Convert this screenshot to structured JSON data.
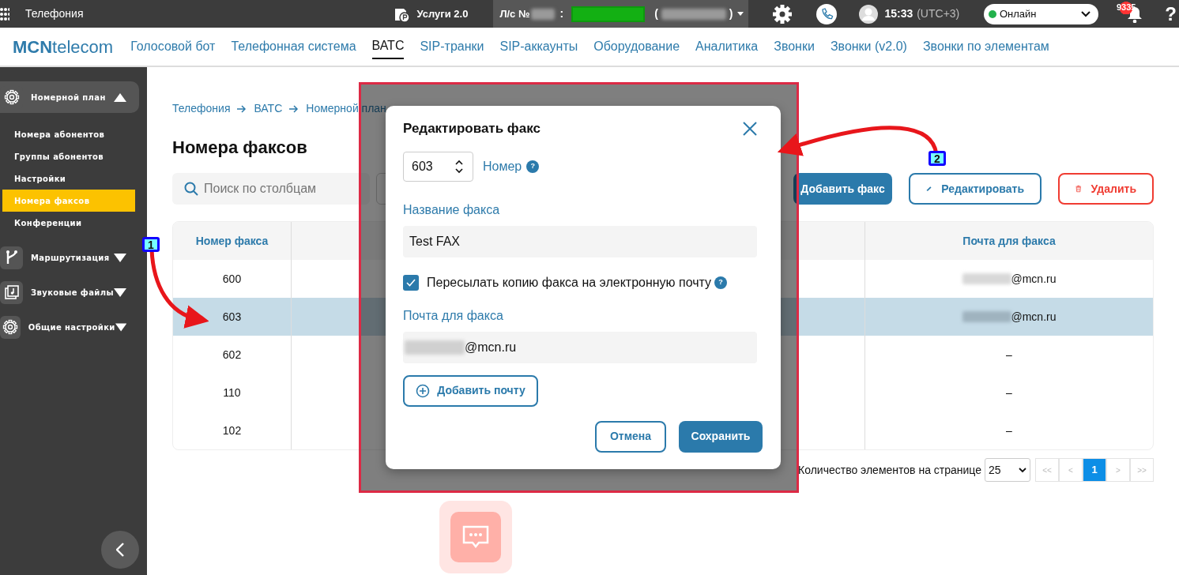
{
  "topbar": {
    "app_title": "Телефония",
    "services": "Услуги 2.0",
    "account_label": "Л/с №",
    "account_sep": ":",
    "paren_open": "(",
    "paren_close": ")",
    "time": "15:33",
    "timezone": "(UTC+3)",
    "status": {
      "label": "Онлайн",
      "color": "#22b14c"
    },
    "notifications": "9335",
    "help": "?"
  },
  "navbar": {
    "logo": "**MCN**telecom",
    "links": [
      {
        "label": "Голосовой бот",
        "selected": false
      },
      {
        "label": "Телефонная система",
        "selected": false
      },
      {
        "label": "ВАТС",
        "selected": true
      },
      {
        "label": "SIP-транки",
        "selected": false
      },
      {
        "label": "SIP-аккаунты",
        "selected": false
      },
      {
        "label": "Оборудование",
        "selected": false
      },
      {
        "label": "Аналитика",
        "selected": false
      },
      {
        "label": "Звонки",
        "selected": false
      },
      {
        "label": "Звонки (v2.0)",
        "selected": false
      },
      {
        "label": "Звонки по элементам",
        "selected": false
      }
    ]
  },
  "sidebar": {
    "sections": [
      {
        "label": "Номерной план",
        "kind": "gear",
        "expanded": true,
        "children": [
          {
            "label": "Номера абонентов",
            "selected": false
          },
          {
            "label": "Группы абонентов",
            "selected": false
          },
          {
            "label": "Настройки",
            "selected": false
          },
          {
            "label": "Номера факсов",
            "selected": true
          },
          {
            "label": "Конференции",
            "selected": false
          }
        ]
      },
      {
        "label": "Маршрутизация",
        "kind": "branch",
        "expanded": false
      },
      {
        "label": "Звуковые файлы",
        "kind": "music",
        "expanded": false
      },
      {
        "label": "Общие настройки",
        "kind": "gear",
        "expanded": false
      }
    ]
  },
  "breadcrumb": [
    "Телефония",
    "ВАТС",
    "Номерной план"
  ],
  "page_title": "Номера факсов",
  "search": {
    "placeholder": "Поиск по столбцам"
  },
  "buttons": [
    {
      "label": "Добавить факс",
      "kind": "primary"
    },
    {
      "label": "Редактировать",
      "kind": "edit"
    },
    {
      "label": "Удалить",
      "kind": "delete"
    }
  ],
  "table": {
    "columns": [
      {
        "label": "Номер факса"
      },
      {
        "label": "Почта для факса"
      }
    ],
    "rows": [
      {
        "number": "600",
        "email": "@mcn.ru",
        "redacted": true,
        "selected": false
      },
      {
        "number": "603",
        "email": "@mcn.ru",
        "redacted": true,
        "selected": true
      },
      {
        "number": "602",
        "email": "–",
        "redacted": false,
        "selected": false
      },
      {
        "number": "110",
        "email": "–",
        "redacted": false,
        "selected": false
      },
      {
        "number": "102",
        "email": "–",
        "redacted": false,
        "selected": false
      }
    ]
  },
  "pagination": {
    "label": "Количество элементов на странице",
    "page_size": "25",
    "first": "<<",
    "prev": "<",
    "pages": [
      {
        "label": "1",
        "selected": true
      }
    ],
    "next": ">",
    "last": ">>"
  },
  "dialog": {
    "title": "Редактировать факс",
    "number": {
      "value": "603",
      "label": "Номер",
      "help": "?"
    },
    "name_label": "Название факса",
    "name_value": "Test FAX",
    "forward": {
      "label": "Пересылать копию факса на электронную почту",
      "checked": true,
      "help": "?"
    },
    "email_label": "Почта для факса",
    "emails": [
      {
        "value": "@mcn.ru",
        "redacted": true
      }
    ],
    "add_email": "Добавить почту",
    "cancel": "Отмена",
    "save": "Сохранить"
  },
  "annotations": [
    {
      "label": "1"
    },
    {
      "label": "2"
    }
  ]
}
